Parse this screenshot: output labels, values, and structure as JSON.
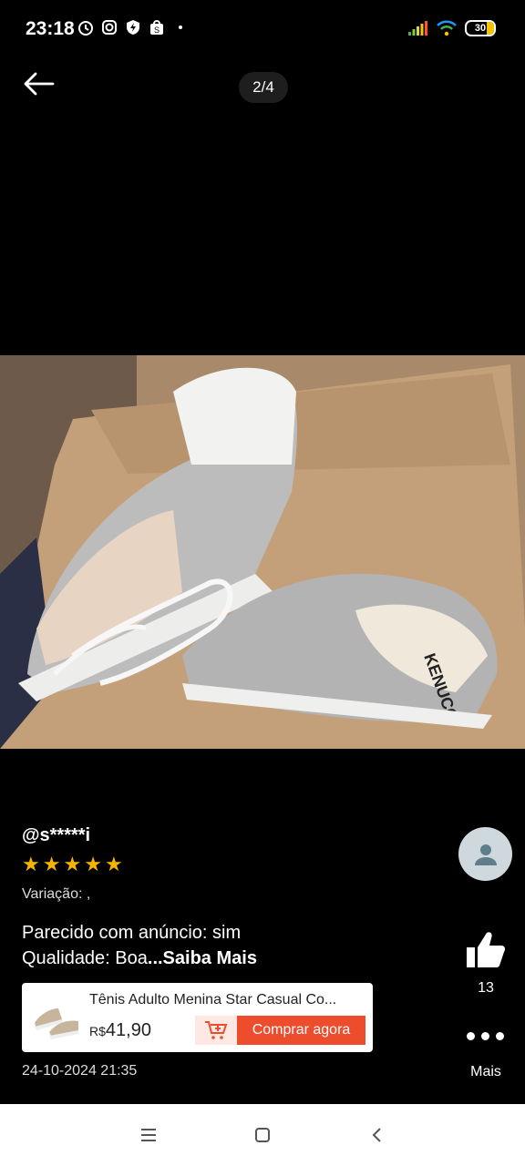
{
  "status": {
    "time": "23:18",
    "battery": "30"
  },
  "viewer": {
    "counter": "2/4"
  },
  "review": {
    "user": "@s*****i",
    "rating": 5,
    "stars": [
      "★",
      "★",
      "★",
      "★",
      "★"
    ],
    "variation": "Variação: ,",
    "line1": "Parecido com anúncio: sim",
    "line2": "Qualidade: Boa",
    "more": "...Saiba Mais",
    "date": "24-10-2024 21:35"
  },
  "actions": {
    "likes": "13",
    "more_label": "Mais"
  },
  "product": {
    "title": "Tênis Adulto Menina Star Casual Co...",
    "currency": "R$",
    "price": "41,90",
    "buy_label": "Comprar agora"
  },
  "colors": {
    "accent": "#ee4d2d",
    "star": "#f6b400"
  }
}
